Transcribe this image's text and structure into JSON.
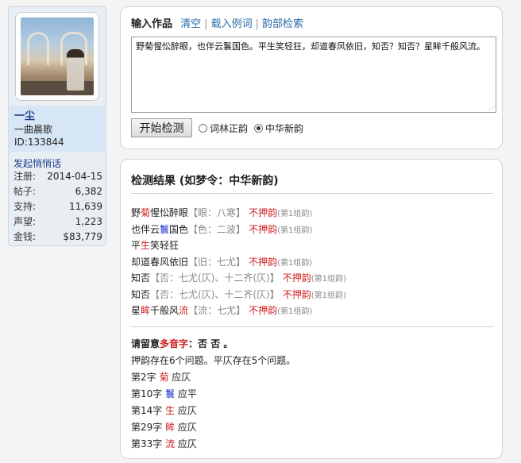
{
  "user": {
    "name": "一尘",
    "subtitle": "一曲晨歌",
    "id": "ID:133844",
    "pm_link": "发起悄悄话",
    "stats": [
      {
        "label": "注册:",
        "value": "2014-04-15"
      },
      {
        "label": "帖子:",
        "value": "6,382"
      },
      {
        "label": "支持:",
        "value": "11,639"
      },
      {
        "label": "声望:",
        "value": "1,223"
      },
      {
        "label": "金钱:",
        "value": "$83,779"
      }
    ]
  },
  "input": {
    "title": "输入作品",
    "clear": "清空",
    "load_example": "载入例词",
    "rhyme_search": "韵部检索",
    "sep": "|",
    "poem": "野菊惺忪醉眼，也伴云鬟国色。平生笑轻狂，却道春风依旧，知否？知否？星眸千般风流。",
    "start_button": "开始检测",
    "options": [
      {
        "label": "词林正韵",
        "checked": false
      },
      {
        "label": "中华新韵",
        "checked": true
      }
    ]
  },
  "result": {
    "title": "检测结果 (如梦令：中华新韵)",
    "lines": [
      {
        "segments": [
          {
            "t": "野",
            "c": ""
          },
          {
            "t": "菊",
            "c": "red"
          },
          {
            "t": "惺忪醉眼",
            "c": ""
          }
        ],
        "rhyme": "【眼：八寒】",
        "status": "不押韵",
        "group": "(第1组韵)"
      },
      {
        "segments": [
          {
            "t": "也伴云",
            "c": ""
          },
          {
            "t": "鬟",
            "c": "blue"
          },
          {
            "t": "国色",
            "c": ""
          }
        ],
        "rhyme": "【色：二波】",
        "status": "不押韵",
        "group": "(第1组韵)"
      },
      {
        "segments": [
          {
            "t": "平",
            "c": ""
          },
          {
            "t": "生",
            "c": "red"
          },
          {
            "t": "笑轻狂",
            "c": ""
          }
        ],
        "rhyme": "",
        "status": "",
        "group": ""
      },
      {
        "segments": [
          {
            "t": "却道春风依旧",
            "c": ""
          }
        ],
        "rhyme": "【旧：七尤】",
        "status": "不押韵",
        "group": "(第1组韵)"
      },
      {
        "segments": [
          {
            "t": "知否",
            "c": ""
          }
        ],
        "rhyme": "【否：七尤(仄)、十二齐(仄)】",
        "status": "不押韵",
        "group": "(第1组韵)"
      },
      {
        "segments": [
          {
            "t": "知否",
            "c": ""
          }
        ],
        "rhyme": "【否：七尤(仄)、十二齐(仄)】",
        "status": "不押韵",
        "group": "(第1组韵)"
      },
      {
        "segments": [
          {
            "t": "星",
            "c": ""
          },
          {
            "t": "眸",
            "c": "red"
          },
          {
            "t": "千般风",
            "c": ""
          },
          {
            "t": "流",
            "c": "red"
          }
        ],
        "rhyme": "【流：七尤】",
        "status": "不押韵",
        "group": "(第1组韵)"
      }
    ],
    "polyphone": {
      "prefix": "请留意",
      "word": "多音字",
      "suffix": "：否 否 。"
    },
    "summary": "押韵存在6个问题。平仄存在5个问题。",
    "issues": [
      {
        "pre": "第2字 ",
        "ch": "菊",
        "color": "red",
        "post": " 应仄"
      },
      {
        "pre": "第10字 ",
        "ch": "鬟",
        "color": "blue",
        "post": " 应平"
      },
      {
        "pre": "第14字 ",
        "ch": "生",
        "color": "red",
        "post": " 应仄"
      },
      {
        "pre": "第29字 ",
        "ch": "眸",
        "color": "red",
        "post": " 应仄"
      },
      {
        "pre": "第33字 ",
        "ch": "流",
        "color": "red",
        "post": " 应仄"
      }
    ]
  }
}
